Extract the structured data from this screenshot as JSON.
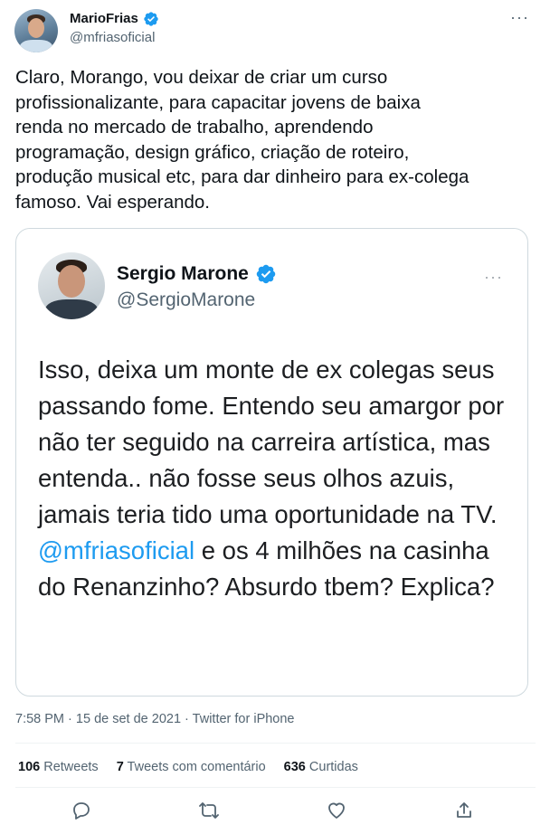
{
  "author": {
    "name": "MarioFrias",
    "handle": "@mfriasoficial"
  },
  "tweet": {
    "text": "Claro, Morango, vou deixar de criar um curso\nprofissionalizante, para capacitar jovens de baixa\nrenda no mercado de trabalho, aprendendo\nprogramação, design gráfico, criação de roteiro,\nprodução musical etc, para dar dinheiro para ex-colega\nfamoso. Vai esperando.",
    "more": "···"
  },
  "quote": {
    "name": "Sergio Marone",
    "handle": "@SergioMarone",
    "more": "···",
    "text_before": "Isso, deixa um monte de ex colegas seus passando fome. Entendo seu amargor por não ter seguido na carreira artística, mas entenda.. não fosse seus olhos azuis, jamais teria tido uma oportunidade na TV.",
    "mention": "@mfriasoficial",
    "text_after": " e os 4 milhões na casinha do Renanzinho? Absurdo tbem? Explica?"
  },
  "meta": {
    "time": "7:58 PM",
    "date": "15 de set de 2021",
    "source": "Twitter for iPhone",
    "separator": "·"
  },
  "stats": {
    "retweets_count": "106",
    "retweets_label": "Retweets",
    "quotes_count": "7",
    "quotes_label": "Tweets com comentário",
    "likes_count": "636",
    "likes_label": "Curtidas"
  },
  "colors": {
    "accent": "#1d9bf0",
    "secondary_text": "#536471",
    "border": "#cfd9de"
  },
  "icons": [
    "verified-badge-icon",
    "more-icon",
    "reply-icon",
    "retweet-icon",
    "like-icon",
    "share-icon"
  ]
}
